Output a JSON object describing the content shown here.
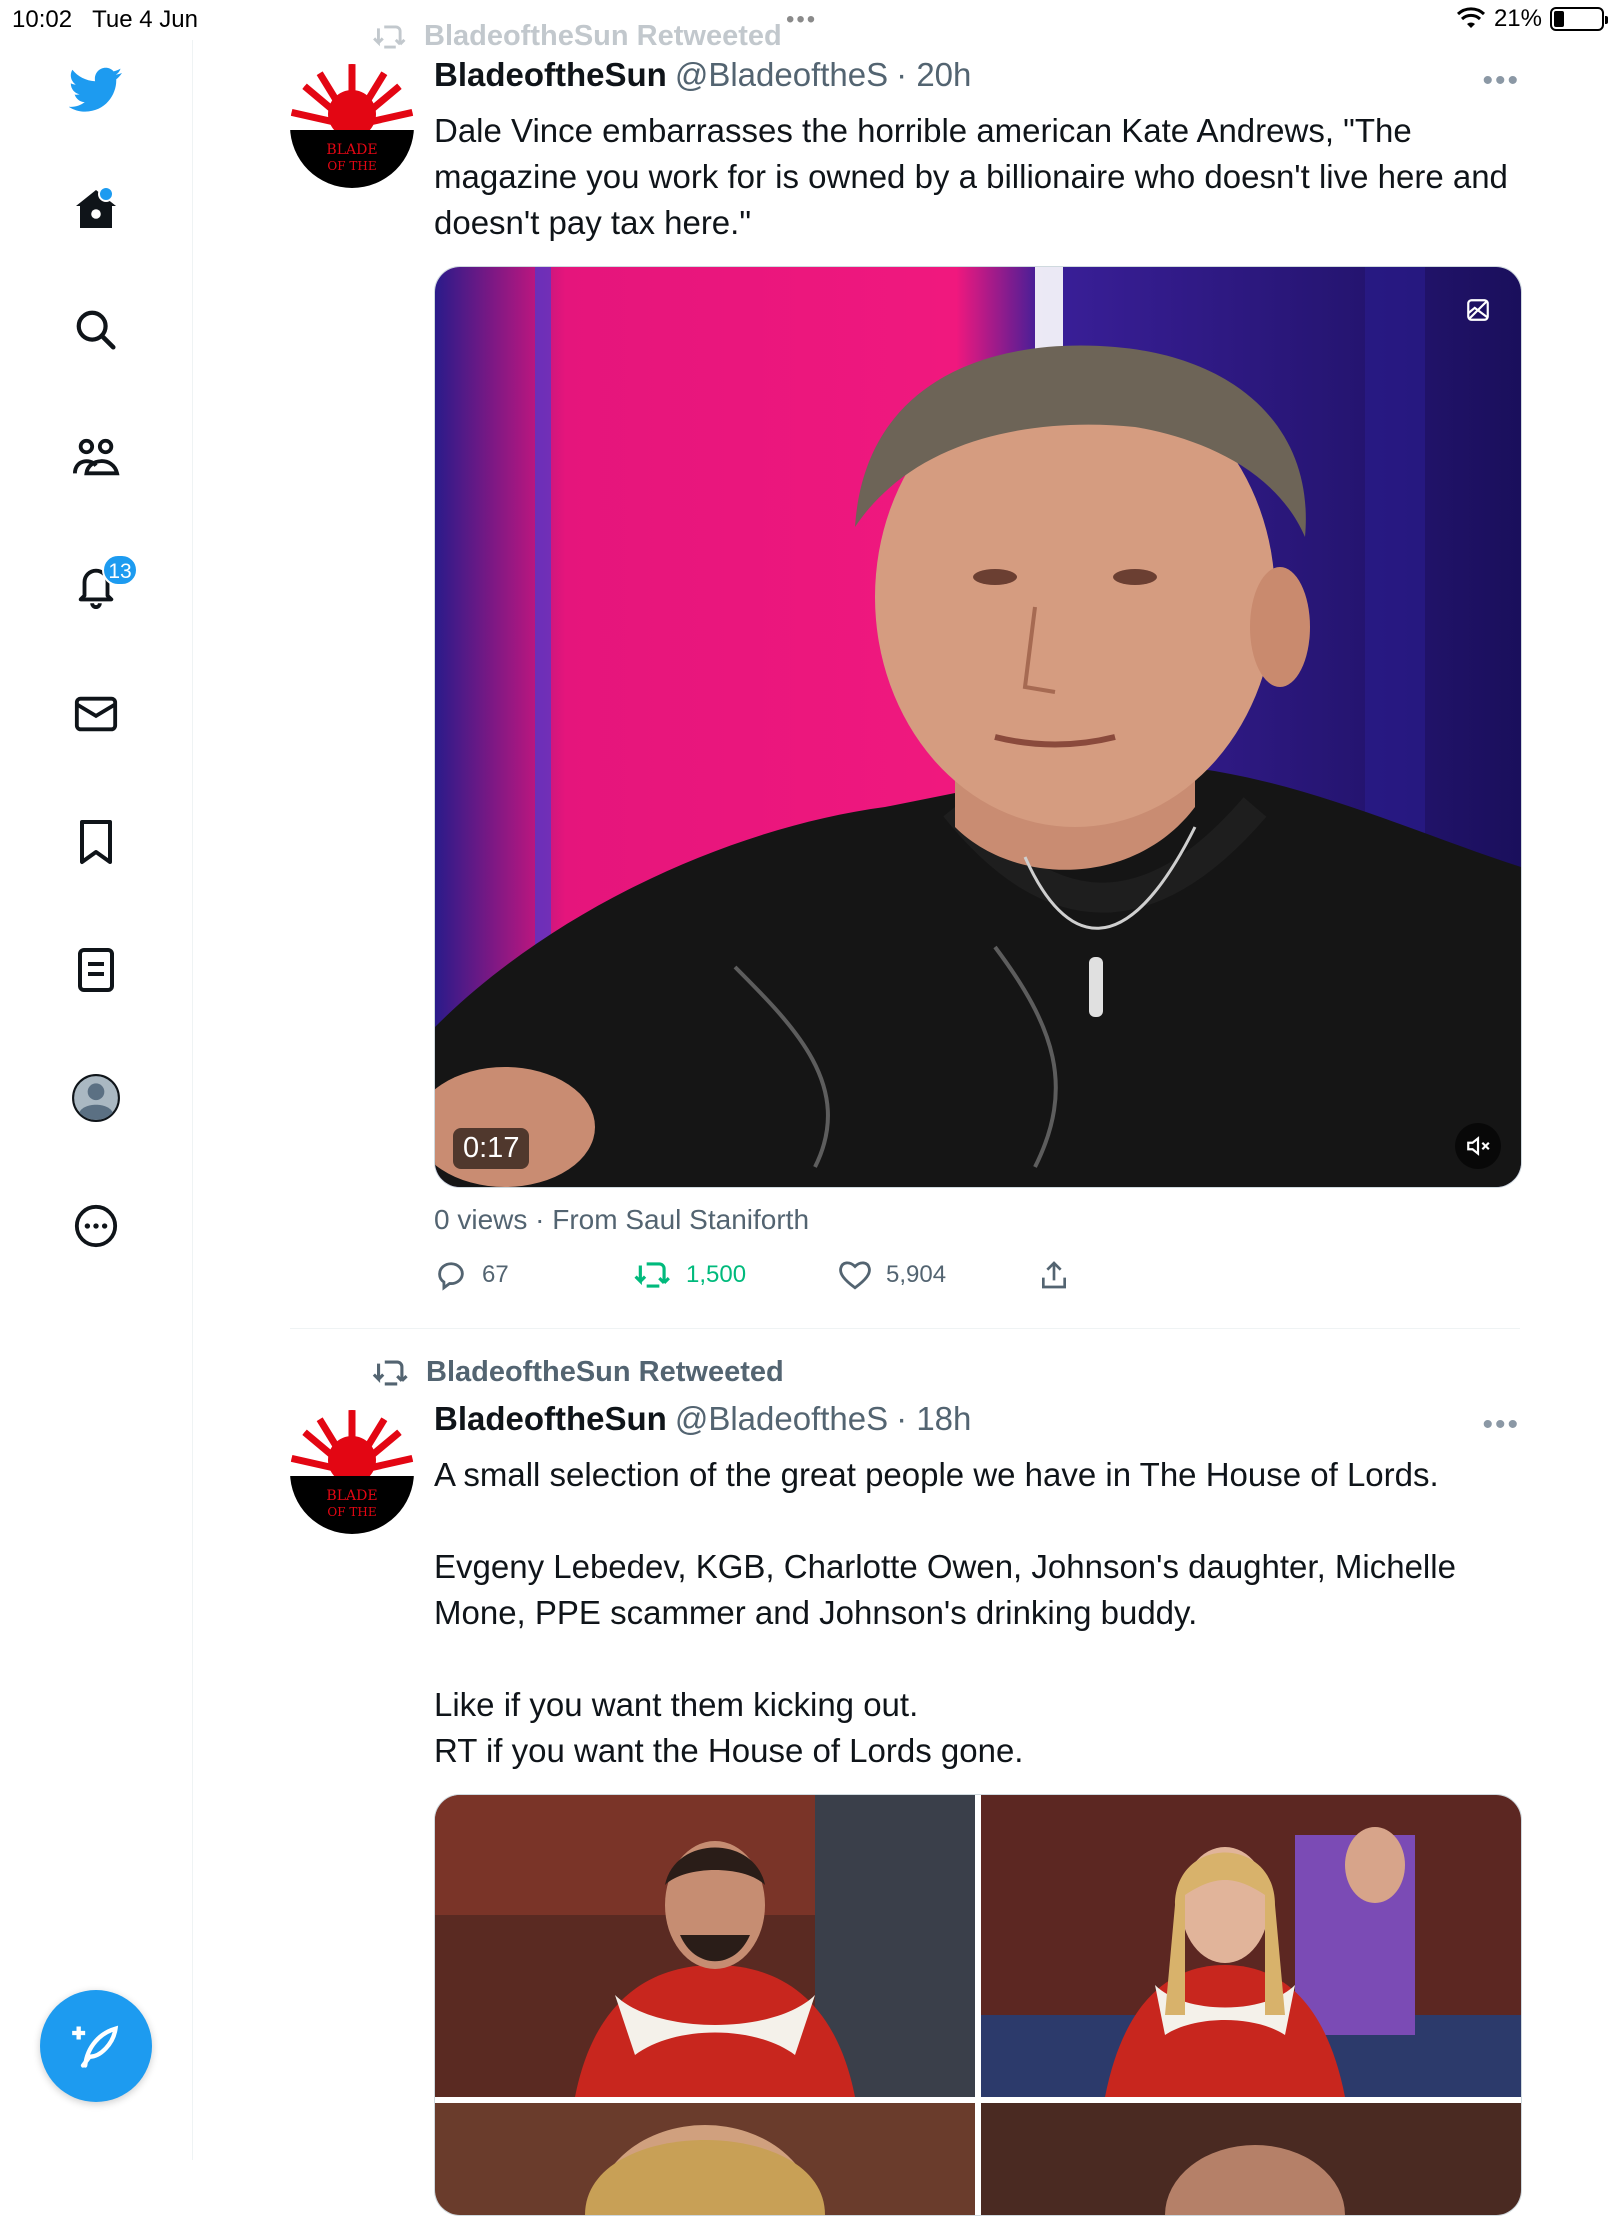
{
  "status_bar": {
    "time": "10:02",
    "date": "Tue 4 Jun",
    "battery": "21%",
    "battery_level": 0.21
  },
  "sidebar": {
    "notifications_count": "13",
    "items": [
      "twitter-logo",
      "home",
      "search",
      "communities",
      "notifications",
      "messages",
      "bookmarks",
      "lists",
      "profile",
      "more"
    ]
  },
  "tweets": [
    {
      "retweet_label": "BladeoftheSun Retweeted",
      "name": "BladeoftheSun",
      "handle": "@BladeoftheS",
      "time": "· 20h",
      "text": "Dale Vince embarrasses the horrible american Kate Andrews, \"The magazine you work for is owned by a billionaire who doesn't live here and doesn't pay tax here.\"",
      "avatar_text": "BLADE OF THE SUN",
      "video_duration": "0:17",
      "views_line": "0 views · From Saul Staniforth",
      "replies": "67",
      "retweets": "1,500",
      "likes": "5,904"
    },
    {
      "retweet_label": "BladeoftheSun Retweeted",
      "name": "BladeoftheSun",
      "handle": "@BladeoftheS",
      "time": "· 18h",
      "text": "A small selection of the great people we have in The House of Lords.\n\nEvgeny Lebedev, KGB, Charlotte Owen, Johnson's daughter, Michelle Mone, PPE scammer and Johnson's drinking buddy.\n\nLike if you want them kicking out.\nRT if you want the House of Lords gone.",
      "avatar_text": "BLADE OF THE SUN"
    }
  ],
  "colors": {
    "accent": "#1d9bf0",
    "retweet_green": "#00ba7c",
    "text": "#0f1419",
    "muted": "#536471"
  }
}
